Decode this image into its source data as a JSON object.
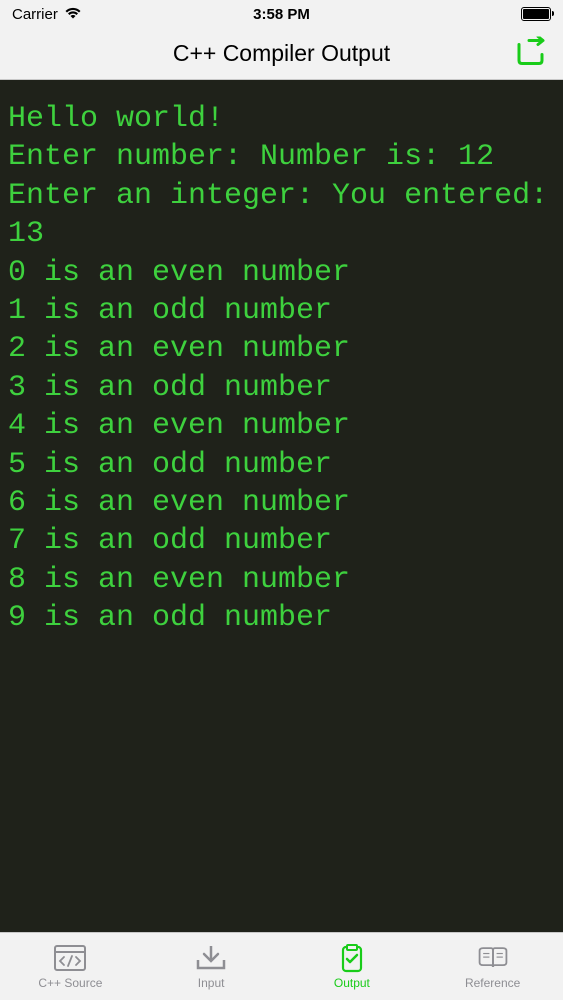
{
  "status": {
    "carrier": "Carrier",
    "time": "3:58 PM"
  },
  "nav": {
    "title": "C++ Compiler Output"
  },
  "console": {
    "output": "Hello world!\nEnter number: Number is: 12\nEnter an integer: You entered: 13\n0 is an even number\n1 is an odd number\n2 is an even number\n3 is an odd number\n4 is an even number\n5 is an odd number\n6 is an even number\n7 is an odd number\n8 is an even number\n9 is an odd number"
  },
  "tabs": {
    "source": "C++ Source",
    "input": "Input",
    "output": "Output",
    "reference": "Reference"
  },
  "colors": {
    "accent": "#19cc19",
    "console_bg": "#1f221a",
    "console_text": "#3ed13e"
  }
}
